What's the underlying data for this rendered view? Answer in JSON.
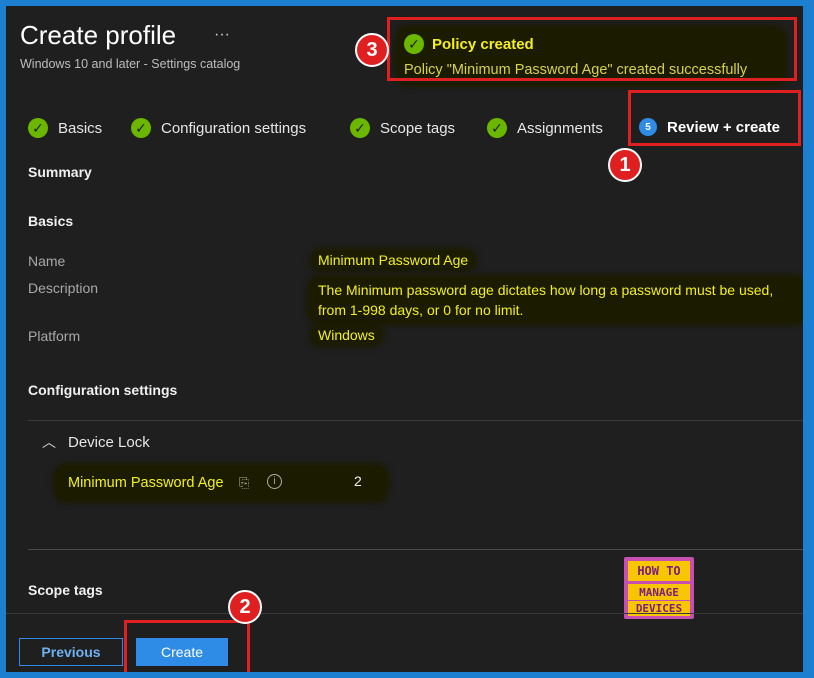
{
  "header": {
    "title": "Create profile",
    "subtitle": "Windows 10 and later - Settings catalog",
    "more": "···"
  },
  "notification": {
    "title": "Policy created",
    "message": "Policy \"Minimum Password Age\" created successfully"
  },
  "steps": [
    {
      "label": "Basics",
      "state": "done"
    },
    {
      "label": "Configuration settings",
      "state": "done"
    },
    {
      "label": "Scope tags",
      "state": "done"
    },
    {
      "label": "Assignments",
      "state": "done"
    },
    {
      "label": "Review + create",
      "state": "current",
      "number": "5"
    }
  ],
  "summary": {
    "heading": "Summary",
    "basics_heading": "Basics",
    "name_label": "Name",
    "name_value": "Minimum Password Age",
    "description_label": "Description",
    "description_line1": "The Minimum password age dictates how long a password must be used,",
    "description_line2": "from 1-998 days, or 0 for no limit.",
    "platform_label": "Platform",
    "platform_value": "Windows",
    "config_heading": "Configuration settings",
    "device_lock": "Device Lock",
    "setting_name": "Minimum Password Age",
    "setting_value": "2",
    "scope_heading": "Scope tags"
  },
  "footer": {
    "previous": "Previous",
    "create": "Create"
  },
  "annotations": {
    "badge1": "1",
    "badge2": "2",
    "badge3": "3"
  },
  "logo": {
    "line1": "HOW TO",
    "line2": "MANAGE",
    "line3": "DEVICES"
  },
  "colors": {
    "accent": "#2f8ce6",
    "success": "#6bb700",
    "highlight": "#f4f01f",
    "annotation": "#e02020"
  }
}
